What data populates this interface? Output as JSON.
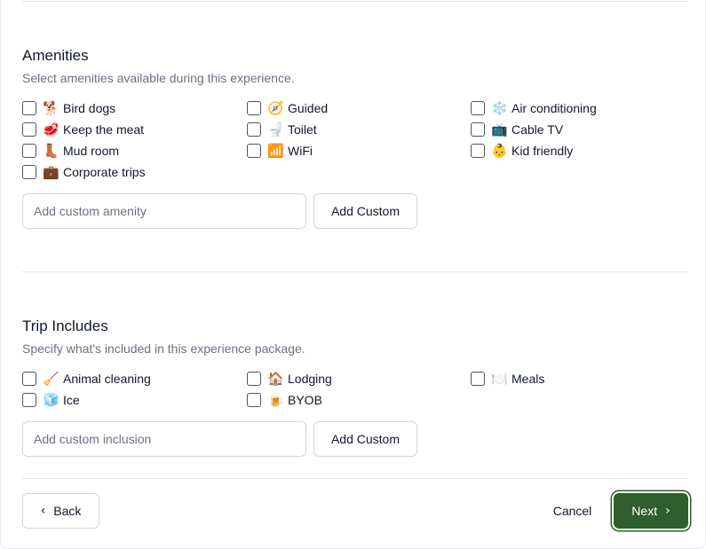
{
  "amenities": {
    "title": "Amenities",
    "description": "Select amenities available during this experience.",
    "options": [
      {
        "icon": "🐕",
        "label": "Bird dogs"
      },
      {
        "icon": "🧭",
        "label": "Guided"
      },
      {
        "icon": "❄️",
        "label": "Air conditioning"
      },
      {
        "icon": "🥩",
        "label": "Keep the meat"
      },
      {
        "icon": "🚽",
        "label": "Toilet"
      },
      {
        "icon": "📺",
        "label": "Cable TV"
      },
      {
        "icon": "👢",
        "label": "Mud room"
      },
      {
        "icon": "📶",
        "label": "WiFi"
      },
      {
        "icon": "👶",
        "label": "Kid friendly"
      },
      {
        "icon": "💼",
        "label": "Corporate trips"
      }
    ],
    "custom_placeholder": "Add custom amenity",
    "add_custom_label": "Add Custom"
  },
  "includes": {
    "title": "Trip Includes",
    "description": "Specify what's included in this experience package.",
    "options": [
      {
        "icon": "🧹",
        "label": "Animal cleaning"
      },
      {
        "icon": "🏠",
        "label": "Lodging"
      },
      {
        "icon": "🍽️",
        "label": "Meals"
      },
      {
        "icon": "🧊",
        "label": "Ice"
      },
      {
        "icon": "🍺",
        "label": "BYOB"
      }
    ],
    "custom_placeholder": "Add custom inclusion",
    "add_custom_label": "Add Custom"
  },
  "footer": {
    "back_label": "Back",
    "cancel_label": "Cancel",
    "next_label": "Next"
  },
  "colors": {
    "primary": "#2e5f2c",
    "border": "#d1d5db",
    "muted_text": "#6b7280"
  }
}
